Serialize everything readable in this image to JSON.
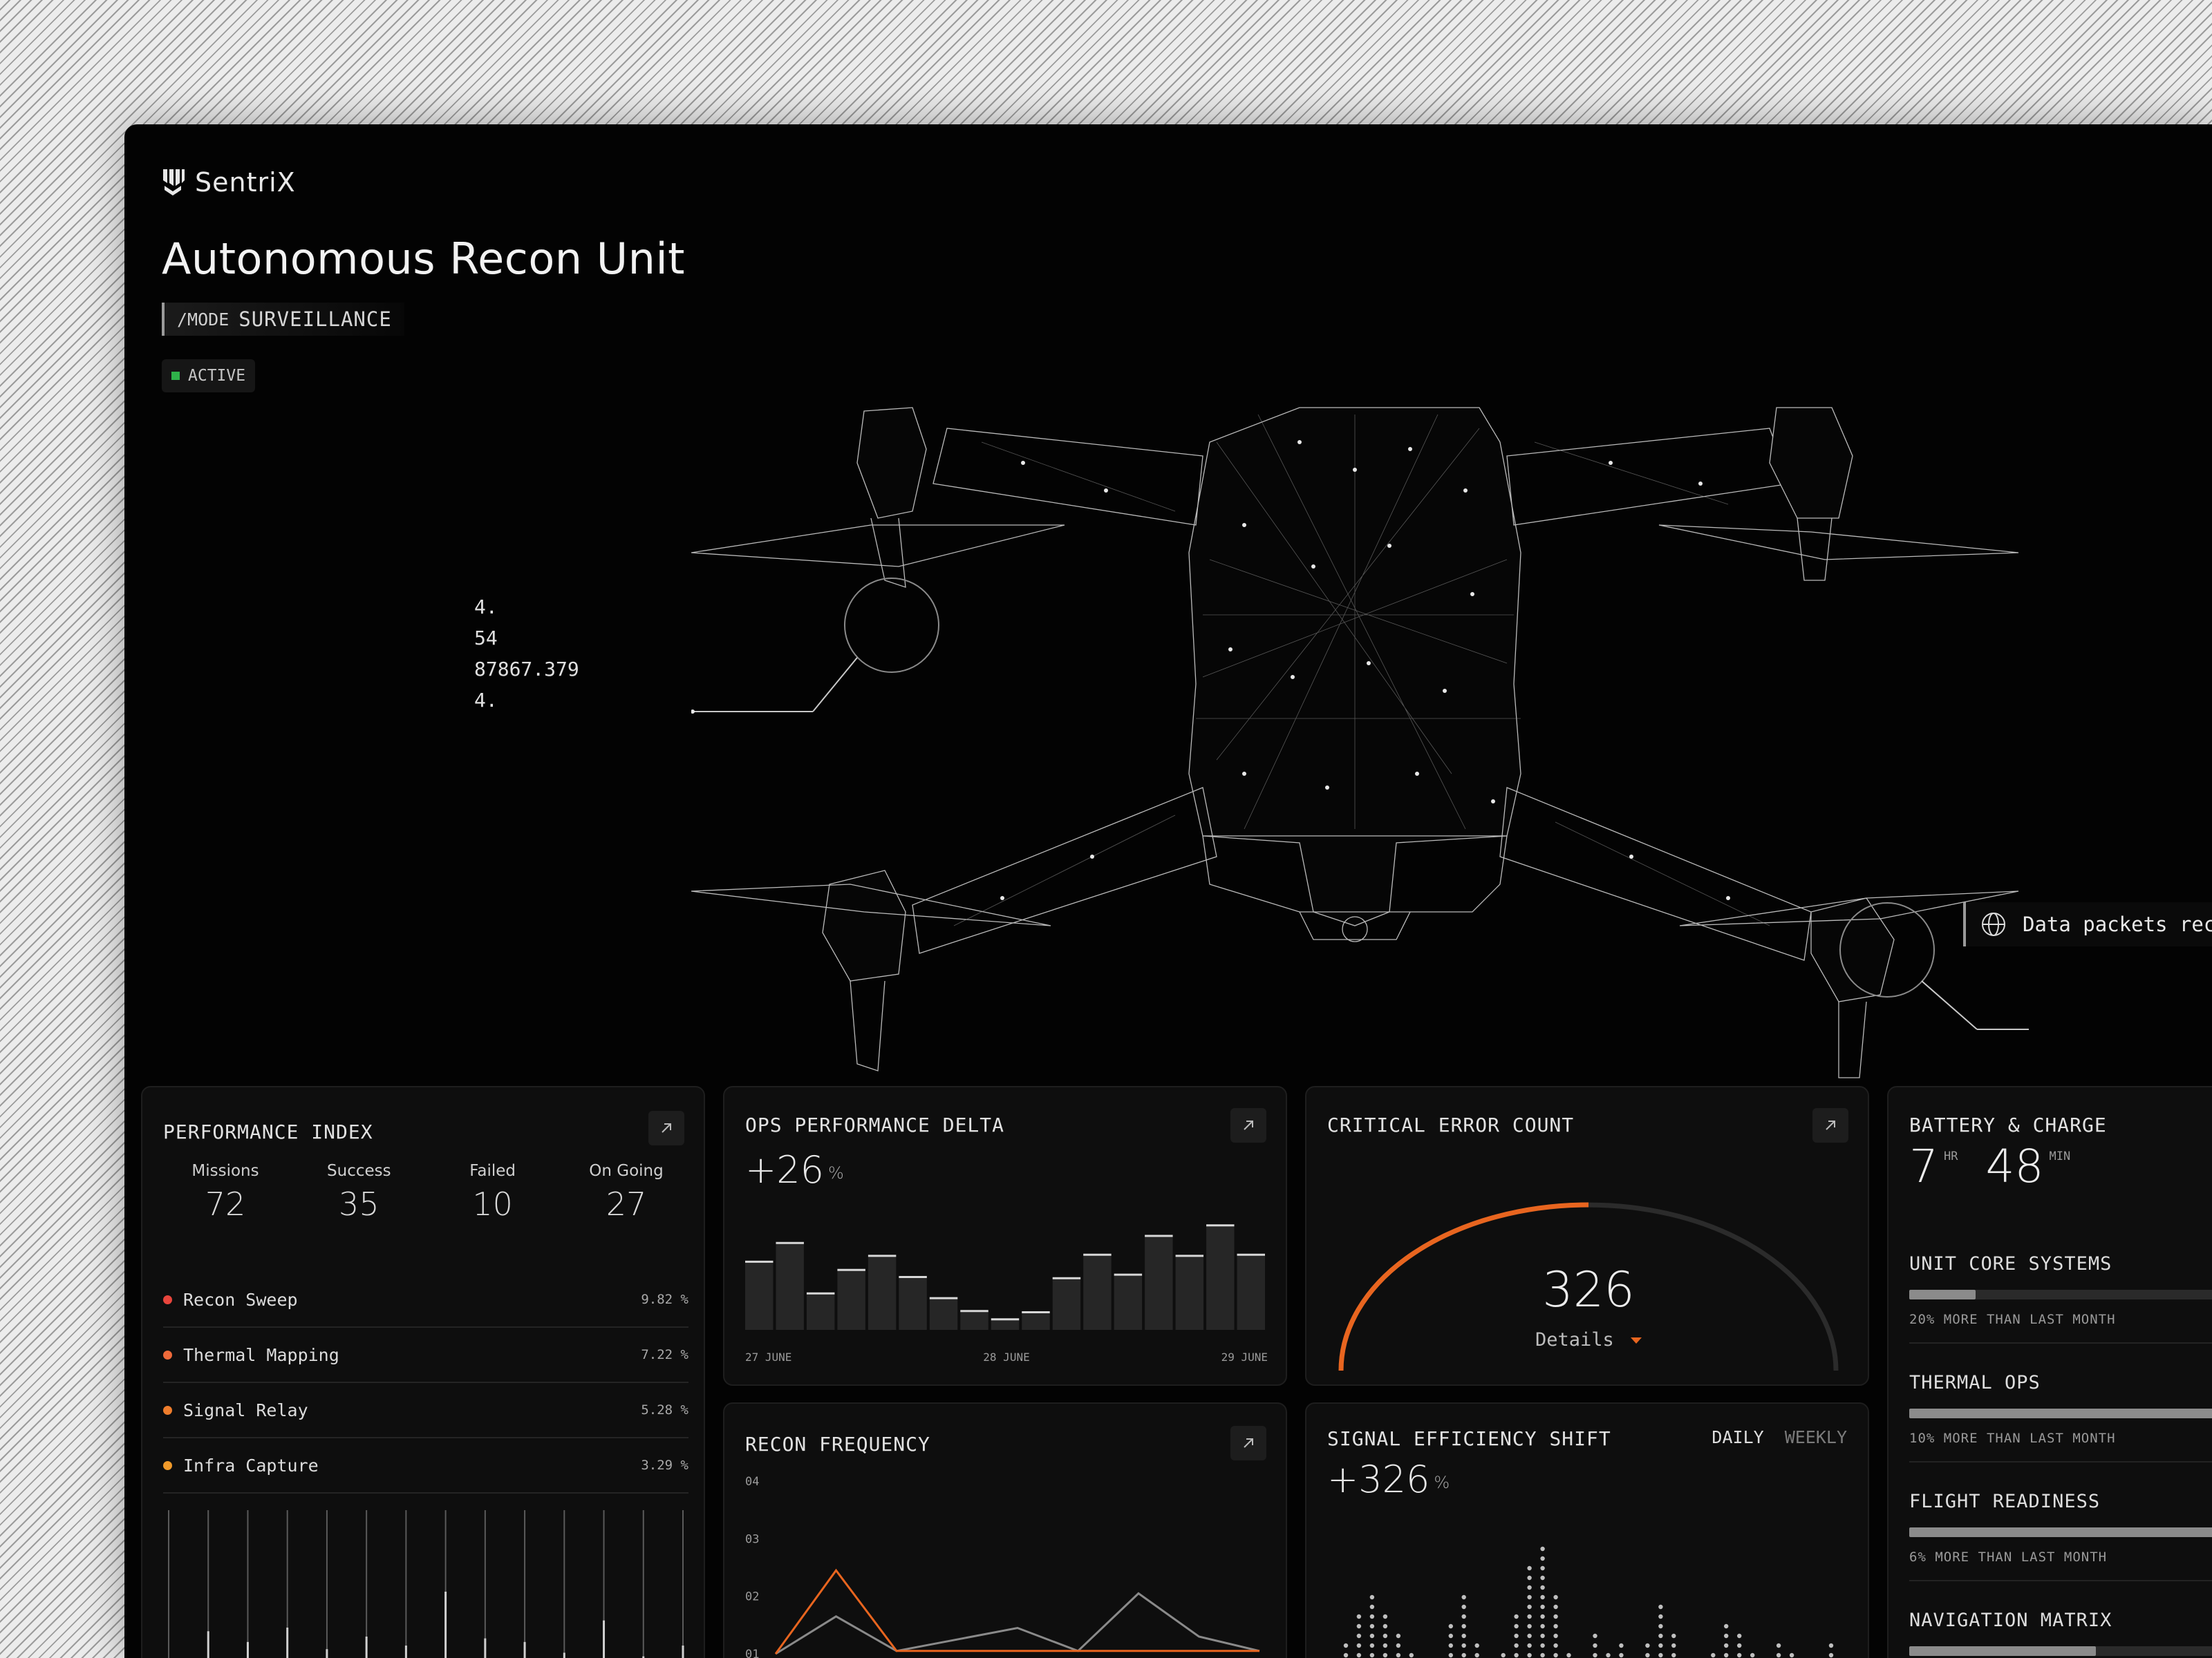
{
  "brand": {
    "name": "SentriX",
    "icon": "sentrix-logo-icon"
  },
  "header": {
    "title": "Autonomous Recon Unit",
    "mode_key": "/MODE",
    "mode_value": "SURVEILLANCE",
    "status": "ACTIVE",
    "status_color": "#2fb24a"
  },
  "readout": {
    "lines": [
      "4.",
      "54",
      "87867.379",
      "4."
    ]
  },
  "callout": {
    "text": "Data packets rec",
    "icon": "globe-icon"
  },
  "performance_index": {
    "title": "PERFORMANCE INDEX",
    "stats": [
      {
        "label": "Missions",
        "value": "72"
      },
      {
        "label": "Success",
        "value": "35"
      },
      {
        "label": "Failed",
        "value": "10"
      },
      {
        "label": "On Going",
        "value": "27"
      }
    ],
    "rows": [
      {
        "name": "Recon Sweep",
        "pct": "9.82 %",
        "color": "#e8453c"
      },
      {
        "name": "Thermal Mapping",
        "pct": "7.22 %",
        "color": "#ef6a3a"
      },
      {
        "name": "Signal Relay",
        "pct": "5.28 %",
        "color": "#ef7d2c"
      },
      {
        "name": "Infra Capture",
        "pct": "3.29 %",
        "color": "#f09a2a"
      }
    ],
    "ticks": [
      0.12,
      0.28,
      0.22,
      0.3,
      0.18,
      0.25,
      0.2,
      0.5,
      0.24,
      0.22,
      0.16,
      0.34,
      0.14,
      0.2
    ]
  },
  "ops_delta": {
    "title": "OPS PERFORMANCE DELTA",
    "value": "+26",
    "unit": "%",
    "dates": [
      "27 JUNE",
      "28 JUNE",
      "29 JUNE"
    ]
  },
  "critical_errors": {
    "title": "CRITICAL ERROR COUNT",
    "value": "326",
    "details": "Details",
    "progress": 0.5,
    "accent": "#e8651f"
  },
  "recon_frequency": {
    "title": "RECON FREQUENCY",
    "y_ticks": [
      "04",
      "03",
      "02",
      "01"
    ]
  },
  "signal_shift": {
    "title": "SIGNAL EFFICIENCY SHIFT",
    "value": "+326",
    "unit": "%",
    "tab_daily": "DAILY",
    "tab_weekly": "WEEKLY"
  },
  "battery": {
    "title": "BATTERY & CHARGE",
    "hours": "7",
    "hours_unit": "HR",
    "minutes": "48",
    "minutes_unit": "MIN",
    "systems": [
      {
        "label": "UNIT CORE SYSTEMS",
        "level": 0.16,
        "note": "20% MORE THAN LAST MONTH"
      },
      {
        "label": "THERMAL OPS",
        "level": 0.75,
        "note": "10% MORE THAN LAST MONTH"
      },
      {
        "label": "FLIGHT READINESS",
        "level": 1.0,
        "note": "6% MORE THAN LAST MONTH"
      },
      {
        "label": "NAVIGATION MATRIX",
        "level": 0.45,
        "note": ""
      }
    ]
  },
  "chart_data": [
    {
      "type": "bar",
      "categories": [
        "",
        "",
        "",
        "",
        "",
        "",
        "",
        "",
        "",
        "",
        "",
        "",
        "",
        "",
        "",
        "",
        ""
      ],
      "values": [
        58,
        74,
        31,
        51,
        63,
        45,
        27,
        16,
        9,
        15,
        44,
        64,
        47,
        80,
        63,
        89,
        64
      ],
      "ylim": [
        0,
        100
      ],
      "xlabel": "",
      "ylabel": "",
      "x_tick_labels": [
        "27 JUNE",
        "28 JUNE",
        "29 JUNE"
      ]
    },
    {
      "type": "line",
      "x": [
        0,
        1,
        2,
        3,
        4,
        5,
        6,
        7,
        8
      ],
      "series": [
        {
          "values": [
            1.0,
            2.45,
            1.05,
            1.05,
            1.05,
            1.05,
            1.05,
            1.05,
            1.05
          ],
          "color": "#e8651f"
        },
        {
          "values": [
            1.0,
            1.65,
            1.05,
            1.25,
            1.45,
            1.05,
            2.05,
            1.3,
            1.05
          ],
          "color": "#8a8a8a"
        }
      ],
      "ylim": [
        1,
        4
      ],
      "y_tick_labels": [
        "01",
        "02",
        "03",
        "04"
      ],
      "xlabel": "",
      "ylabel": ""
    },
    {
      "type": "bar",
      "categories": [],
      "values": [
        2,
        4,
        7,
        9,
        7,
        5,
        3,
        2,
        2,
        6,
        9,
        4,
        2,
        3,
        7,
        12,
        14,
        9,
        3,
        2,
        5,
        3,
        4,
        2,
        4,
        8,
        5,
        2,
        2,
        3,
        6,
        5,
        3,
        2,
        4,
        3,
        2,
        2,
        4,
        2
      ],
      "xlabel": "",
      "ylabel": ""
    }
  ]
}
